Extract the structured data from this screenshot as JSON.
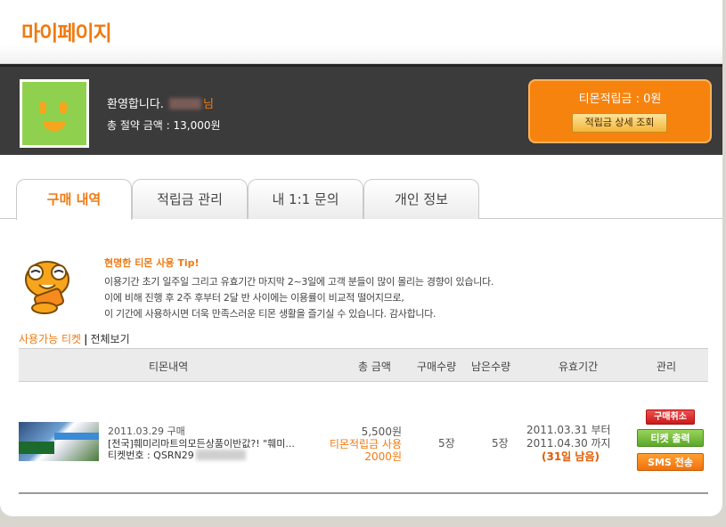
{
  "header": {
    "title": "마이페이지"
  },
  "profile": {
    "welcome": "환영합니다.",
    "name_suffix": "님",
    "savings_label": "총 절약 금액 : 13,000원"
  },
  "points": {
    "label": "티몬적립금 : 0원",
    "detail_button": "적립금 상세 조회"
  },
  "tabs": [
    {
      "label": "구매 내역",
      "active": true
    },
    {
      "label": "적립금 관리",
      "active": false
    },
    {
      "label": "내 1:1 문의",
      "active": false
    },
    {
      "label": "개인 정보",
      "active": false
    }
  ],
  "tip": {
    "title": "현명한 티몬 사용 Tip!",
    "lines": [
      "이용기간 초기 일주일 그리고 유효기간 마지막 2~3일에 고객 분들이 많이 몰리는 경향이 있습니다.",
      "이에 비해 진행 후 2주 후부터 2달 반 사이에는 이용률이 비교적 떨어지므로,",
      "이 기간에 사용하시면 더욱 만족스러운 티몬 생활을 즐기실 수 있습니다. 감사합니다."
    ]
  },
  "section": {
    "available": "사용가능 티켓",
    "separator": "|",
    "view_all": "전체보기"
  },
  "table": {
    "headers": {
      "item": "티몬내역",
      "amount": "총 금액",
      "qty": "구매수량",
      "remaining": "남은수량",
      "period": "유효기간",
      "manage": "관리"
    },
    "rows": [
      {
        "purchase_date": "2011.03.29 구매",
        "title": "[전국]훼미리마트의모든상품이반값?! \"훼미...",
        "ticket_no_label": "티켓번호 : QSRN29",
        "amount": "5,500원",
        "points_used": "티몬적립금 사용",
        "points_amount": "2000원",
        "qty": "5장",
        "remaining": "5장",
        "period_start": "2011.03.31 부터",
        "period_end": "2011.04.30 까지",
        "days_left": "(31일 남음)",
        "buttons": {
          "cancel": "구매취소",
          "print": "티켓 출력",
          "sms": "SMS 전송"
        }
      }
    ]
  },
  "colors": {
    "accent": "#f07a12",
    "profile_bg": "#3b3b3b",
    "points_box": "#f7830f",
    "cancel": "#d92a2a",
    "print": "#6cb83a",
    "sms": "#f58420"
  }
}
